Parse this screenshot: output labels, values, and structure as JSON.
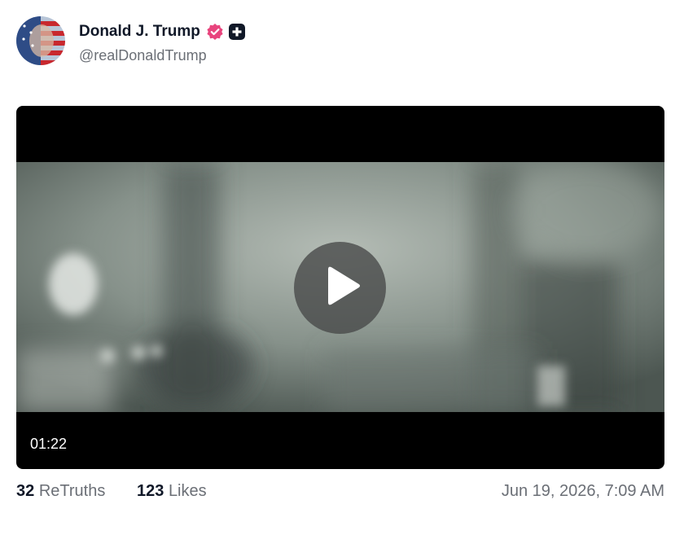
{
  "author": {
    "display_name": "Donald J. Trump",
    "handle": "@realDonaldTrump",
    "verified_icon": "verified-badge-icon",
    "plus_icon": "plus-badge-icon",
    "verified_color": "#e8447d"
  },
  "video": {
    "duration": "01:22",
    "play_icon": "play-icon"
  },
  "stats": {
    "retruths_count": "32",
    "retruths_label": "ReTruths",
    "likes_count": "123",
    "likes_label": "Likes"
  },
  "timestamp": "Jun 19, 2026, 7:09 AM"
}
